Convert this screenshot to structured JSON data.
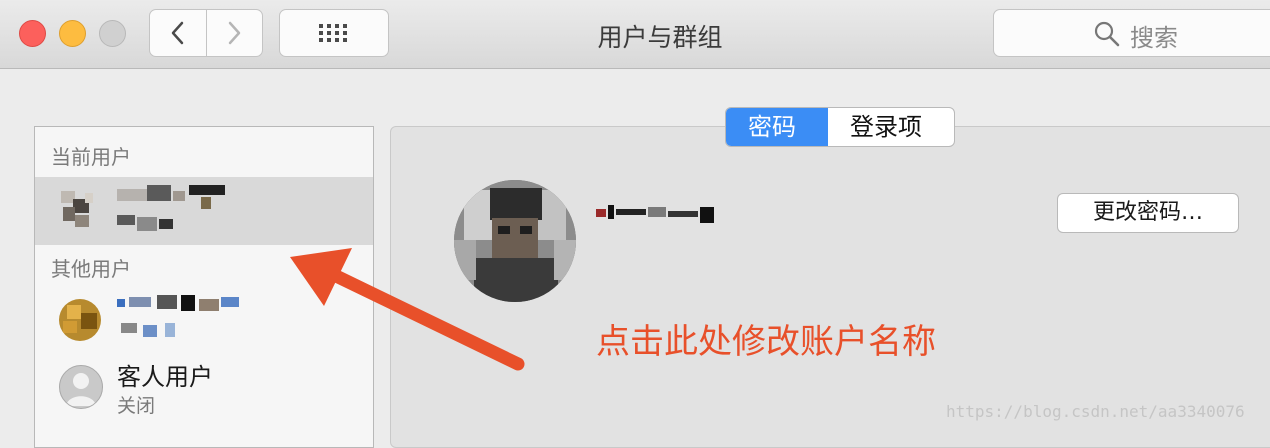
{
  "window": {
    "title": "用户与群组",
    "search_placeholder": "搜索"
  },
  "sidebar": {
    "current_users_header": "当前用户",
    "other_users_header": "其他用户",
    "guest": {
      "name": "客人用户",
      "status": "关闭"
    }
  },
  "tabs": [
    {
      "label": "密码",
      "active": true
    },
    {
      "label": "登录项",
      "active": false
    }
  ],
  "main": {
    "change_password_label": "更改密码…"
  },
  "annotation": {
    "text": "点击此处修改账户名称",
    "color": "#e8502a"
  },
  "watermark": "https://blog.csdn.net/aa3340076",
  "colors": {
    "accent": "#3b8df5",
    "selection": "#d9d9d9",
    "traffic_red": "#fc605c",
    "traffic_yellow": "#fdbc40"
  },
  "icons": [
    "back-chevron-icon",
    "forward-chevron-icon",
    "grid-icon",
    "search-icon",
    "user-silhouette-icon",
    "arrow-annotation-icon"
  ]
}
